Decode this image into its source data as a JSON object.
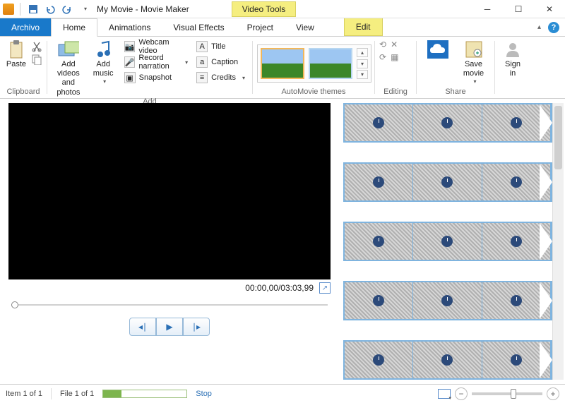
{
  "title": "My Movie - Movie Maker",
  "tool_tab": {
    "context": "Video Tools",
    "tab": "Edit"
  },
  "tabs": {
    "file": "Archivo",
    "items": [
      "Home",
      "Animations",
      "Visual Effects",
      "Project",
      "View"
    ],
    "active": 0
  },
  "ribbon": {
    "clipboard": {
      "label": "Clipboard",
      "paste": "Paste"
    },
    "add": {
      "label": "Add",
      "add_videos": "Add videos\nand photos",
      "add_music": "Add\nmusic",
      "webcam": "Webcam video",
      "record": "Record narration",
      "snapshot": "Snapshot",
      "title": "Title",
      "caption": "Caption",
      "credits": "Credits"
    },
    "automovie": {
      "label": "AutoMovie themes"
    },
    "editing": {
      "label": "Editing"
    },
    "share": {
      "label": "Share",
      "save": "Save\nmovie"
    },
    "signin": {
      "label": "Sign\nin"
    }
  },
  "preview": {
    "time": "00:00,00/03:03,99"
  },
  "status": {
    "item": "Item 1 of 1",
    "file": "File 1 of 1",
    "action": "Stop"
  }
}
